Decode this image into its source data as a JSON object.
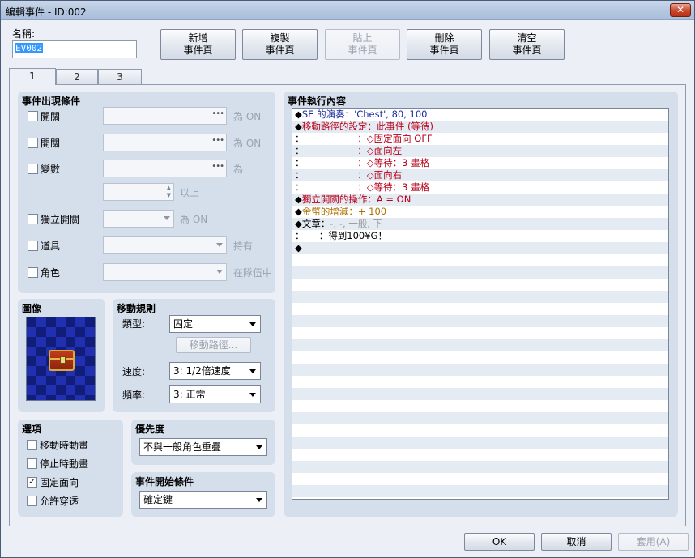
{
  "window": {
    "title": "編輯事件 - ID:002",
    "close_label": "✕"
  },
  "name": {
    "label": "名稱:",
    "value": "EV002"
  },
  "toolbar": {
    "new_page": [
      "新增",
      "事件頁"
    ],
    "copy_page": [
      "複製",
      "事件頁"
    ],
    "paste_page": [
      "貼上",
      "事件頁"
    ],
    "delete_page": [
      "刪除",
      "事件頁"
    ],
    "clear_page": [
      "清空",
      "事件頁"
    ]
  },
  "tabs": [
    "1",
    "2",
    "3"
  ],
  "conditions": {
    "title": "事件出現條件",
    "switch1": {
      "label": "開關",
      "suffix": "為 ON"
    },
    "switch2": {
      "label": "開關",
      "suffix": "為 ON"
    },
    "variable": {
      "label": "變數",
      "suffix": "為",
      "suffix2": "以上"
    },
    "self_switch": {
      "label": "獨立開關",
      "suffix": "為 ON"
    },
    "item": {
      "label": "道具",
      "suffix": "持有"
    },
    "actor": {
      "label": "角色",
      "suffix": "在隊伍中"
    }
  },
  "image": {
    "title": "圖像"
  },
  "movement": {
    "title": "移動規則",
    "type_label": "類型:",
    "type_value": "固定",
    "route_button": "移動路徑...",
    "speed_label": "速度:",
    "speed_value": "3: 1/2倍速度",
    "freq_label": "頻率:",
    "freq_value": "3: 正常"
  },
  "options": {
    "title": "選項",
    "items": [
      {
        "label": "移動時動畫",
        "checked": false
      },
      {
        "label": "停止時動畫",
        "checked": false
      },
      {
        "label": "固定面向",
        "checked": true
      },
      {
        "label": "允許穿透",
        "checked": false
      }
    ]
  },
  "priority": {
    "title": "優先度",
    "value": "不與一般角色重疊"
  },
  "trigger": {
    "title": "事件開始條件",
    "value": "確定鍵"
  },
  "contents": {
    "title": "事件執行內容",
    "lines": [
      {
        "marker": "◆",
        "text": "SE 的演奏：'Chest', 80, 100",
        "color": "blue"
      },
      {
        "marker": "◆",
        "text": "移動路徑的設定：此事件 (等待)",
        "color": "red"
      },
      {
        "marker": "：",
        "text": "                  ：◇固定面向 OFF",
        "color": "red"
      },
      {
        "marker": "：",
        "text": "                  ：◇面向左",
        "color": "red"
      },
      {
        "marker": "：",
        "text": "                  ：◇等待：3 畫格",
        "color": "red"
      },
      {
        "marker": "：",
        "text": "                  ：◇面向右",
        "color": "red"
      },
      {
        "marker": "：",
        "text": "                  ：◇等待：3 畫格",
        "color": "red"
      },
      {
        "marker": "◆",
        "text": "獨立開關的操作：A = ON",
        "color": "red"
      },
      {
        "marker": "◆",
        "text": "金幣的增減：+ 100",
        "color": "gold"
      },
      {
        "marker": "◆",
        "text": "文章：",
        "extra": "-, -, 一般, 下",
        "color": "black"
      },
      {
        "marker": "：",
        "text": "     ：得到100¥G！",
        "color": "black"
      },
      {
        "marker": "◆",
        "text": "",
        "color": "black"
      }
    ]
  },
  "footer": {
    "ok": "OK",
    "cancel": "取消",
    "apply": "套用(A)"
  }
}
